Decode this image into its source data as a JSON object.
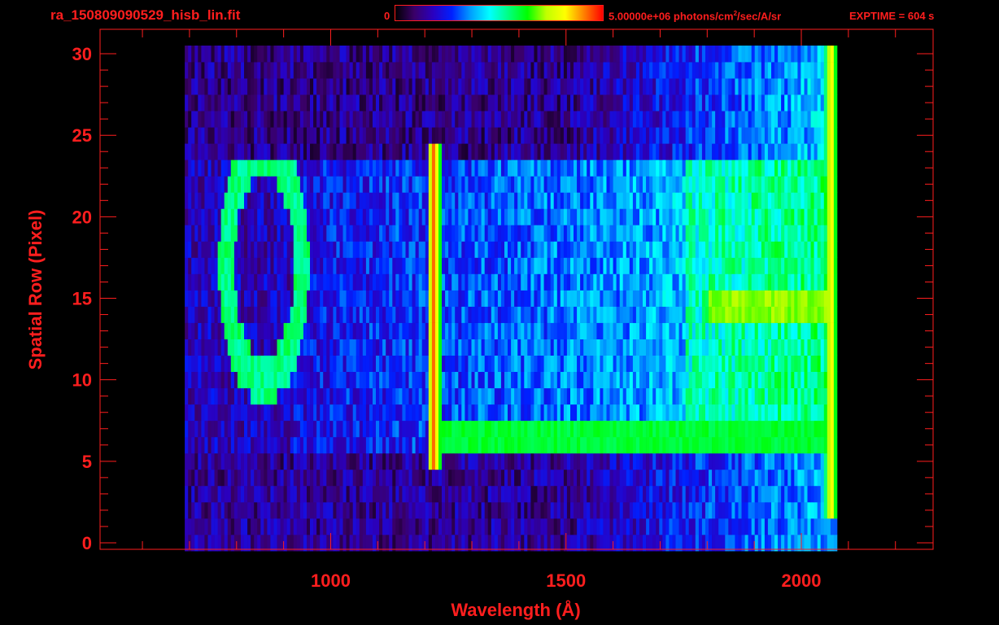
{
  "header": {
    "filename": "ra_150809090529_hisb_lin.fit",
    "colorbar_min": "0",
    "colorbar_max_value": "5.00000e+06",
    "colorbar_units_pre": " photons/cm",
    "colorbar_units_sup": "2",
    "colorbar_units_post": "/sec/A/sr",
    "exptime": "EXPTIME = 604 s"
  },
  "colors": {
    "axis": "#ff1e1e",
    "background": "#000000",
    "colormap": [
      "#000000",
      "#3a0068",
      "#2a00c0",
      "#0020ff",
      "#00a0ff",
      "#00ffff",
      "#00ff80",
      "#00ff00",
      "#c0ff00",
      "#ffff00",
      "#ff8000",
      "#ff0000"
    ]
  },
  "chart_data": {
    "type": "heatmap",
    "title": "",
    "xlabel": "Wavelength (Å)",
    "ylabel": "Spatial Row (Pixel)",
    "xlim": [
      510,
      2280
    ],
    "ylim": [
      -0.4,
      31.5
    ],
    "xticks": [
      1000,
      1500,
      2000
    ],
    "xtick_labels": [
      "1000",
      "1500",
      "2000"
    ],
    "yticks": [
      0,
      5,
      10,
      15,
      20,
      25,
      30
    ],
    "ytick_labels": [
      "0",
      "5",
      "10",
      "15",
      "20",
      "25",
      "30"
    ],
    "colorbar_range": [
      0,
      5000000
    ],
    "grid": false,
    "spectrum_range": [
      690,
      2070
    ],
    "features": [
      {
        "name": "Lyman-alpha emission line",
        "wavelength": 1216,
        "rows": [
          5,
          24
        ],
        "level": 0.95
      },
      {
        "name": "bright band",
        "wavelength_range": [
          1216,
          2060
        ],
        "rows": [
          6,
          7
        ],
        "level": 0.6
      },
      {
        "name": "bright band",
        "wavelength_range": [
          1800,
          2060
        ],
        "rows": [
          14,
          15
        ],
        "level": 0.7
      },
      {
        "name": "edge",
        "wavelength": 2060,
        "rows": [
          2,
          30
        ],
        "level": 0.85
      },
      {
        "name": "ring",
        "center": [
          855,
          17
        ],
        "radius_wavelength": 80,
        "radius_rows": 7,
        "level": 0.55
      }
    ]
  }
}
